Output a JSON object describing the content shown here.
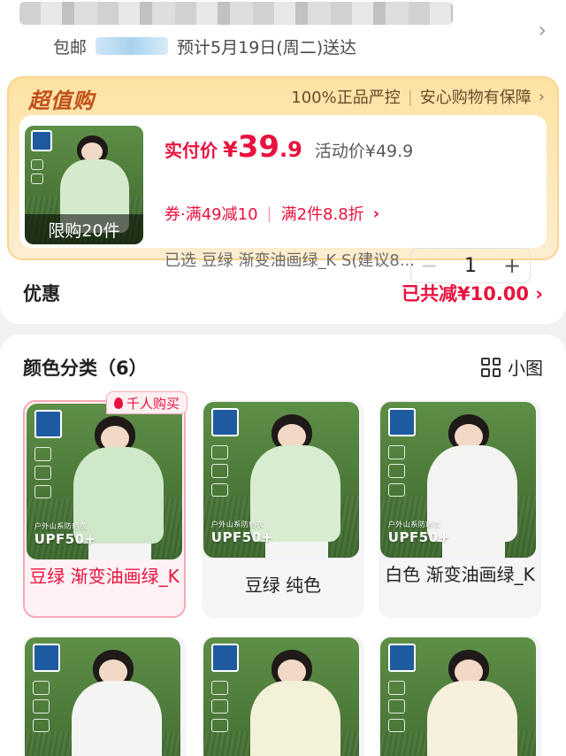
{
  "address": {
    "prefix": "包邮",
    "delivery": "预计5月19日(周二)送达"
  },
  "deal": {
    "title": "超值购",
    "guarantee_1": "100%正品严控",
    "guarantee_2": "安心购物有保障",
    "limit_tag": "限购20件",
    "pay_label": "实付价",
    "pay_yen": "¥",
    "pay_int": "39",
    "pay_dec": ".9",
    "activity_price": "活动价¥49.9",
    "coupon": "券·满49减10",
    "multi_discount": "满2件8.8折",
    "selected_spec": "已选 豆绿 渐变油画绿_K S(建议8...",
    "quantity": "1"
  },
  "discount": {
    "label": "优惠",
    "value": "已共减¥10.00"
  },
  "variants": {
    "header": "颜色分类（6）",
    "view_toggle_label": "小图",
    "hot_badge": "千人购买",
    "items": [
      {
        "label": "豆绿 渐变油画绿_K",
        "jacket_color": "#cfe8c9",
        "selected": true
      },
      {
        "label": "豆绿 纯色",
        "jacket_color": "#d7ecd0",
        "selected": false
      },
      {
        "label": "白色 渐变油画绿_K",
        "jacket_color": "#f3f4f1",
        "selected": false
      },
      {
        "label": "",
        "jacket_color": "#f4f5f2",
        "selected": false
      },
      {
        "label": "",
        "jacket_color": "#f3f1d8",
        "selected": false
      },
      {
        "label": "",
        "jacket_color": "#f6f0dc",
        "selected": false
      }
    ],
    "upf_text": "UPF50+",
    "upf_caption": "户外山系防晒衣"
  },
  "colors": {
    "accent_red": "#e8123e",
    "deal_orange": "#c1501a",
    "deal_bg": "#fde2a3"
  }
}
